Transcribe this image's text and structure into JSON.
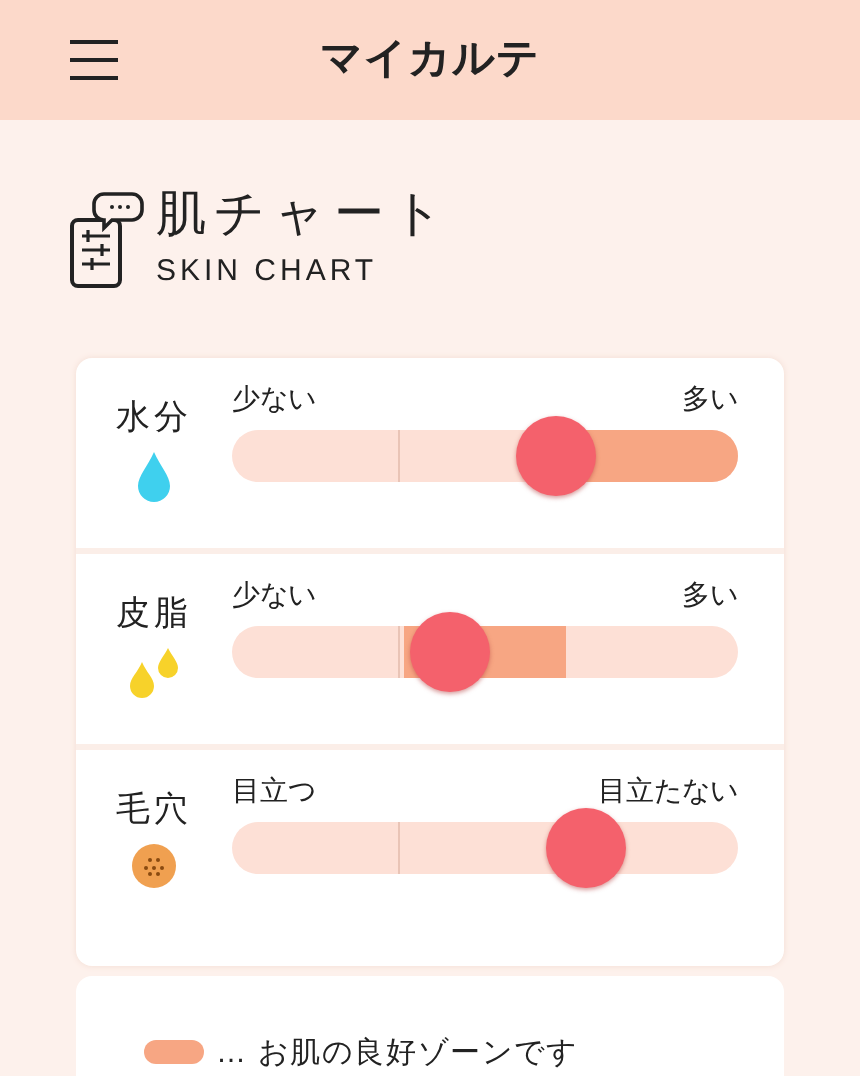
{
  "header": {
    "title": "マイカルテ"
  },
  "section": {
    "title": "肌チャート",
    "subtitle": "SKIN CHART"
  },
  "metrics": [
    {
      "label": "水分",
      "kind": "water",
      "min_label": "少ない",
      "max_label": "多い",
      "level": 0.64
    },
    {
      "label": "皮脂",
      "kind": "oil",
      "min_label": "少ない",
      "max_label": "多い",
      "level": 0.43
    },
    {
      "label": "毛穴",
      "kind": "pores",
      "min_label": "目立つ",
      "max_label": "目立たない",
      "level": 0.7
    }
  ],
  "legend": {
    "text": "… お肌の良好ゾーンです"
  }
}
